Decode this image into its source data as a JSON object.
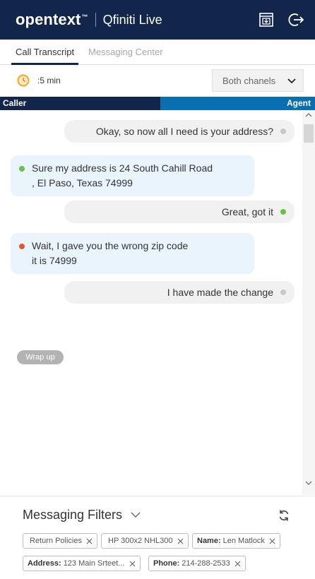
{
  "header": {
    "brand": "opentext",
    "brand_tm": "™",
    "product": "Qfiniti Live",
    "save_icon": "save-window-icon",
    "logout_icon": "logout-arrow-icon"
  },
  "tabs": [
    {
      "label": "Call Transcript",
      "active": true
    },
    {
      "label": "Messaging Center",
      "active": false
    }
  ],
  "controls": {
    "duration": ":5 min",
    "clock_icon": "clock-icon",
    "channel_select": "Both chanels"
  },
  "roles": {
    "caller": "Caller",
    "agent": "Agent"
  },
  "messages": [
    {
      "speaker": "agent",
      "text": "Okay, so now all I need is your address?",
      "status": "grey"
    },
    {
      "speaker": "caller",
      "lines": [
        "Sure my address is 24 South Cahill Road",
        ", El Paso, Texas 74999"
      ],
      "status": "green"
    },
    {
      "speaker": "agent",
      "text": "Great, got it",
      "status": "green"
    },
    {
      "speaker": "caller",
      "lines": [
        "Wait, I gave you the wrong zip code",
        "it is 74999"
      ],
      "status": "orange"
    },
    {
      "speaker": "agent",
      "text": "I have made the change",
      "status": "grey"
    }
  ],
  "wrap_up": "Wrap up",
  "filters": {
    "title": "Messaging Filters",
    "chips": [
      {
        "key": "",
        "value": "Return Policies"
      },
      {
        "key": "",
        "value": "HP 300x2 NHL300"
      },
      {
        "key": "Name:",
        "value": "Len Matlock"
      },
      {
        "key": "Address:",
        "value": "123 Main Srteet..."
      },
      {
        "key": "Phone:",
        "value": "214-288-2533"
      }
    ]
  },
  "colors": {
    "header_bg": "#12254a",
    "agent_bar": "#0a6fb0",
    "status_green": "#6cc04a",
    "status_orange": "#e8572a",
    "clock_accent": "#f5a623"
  }
}
